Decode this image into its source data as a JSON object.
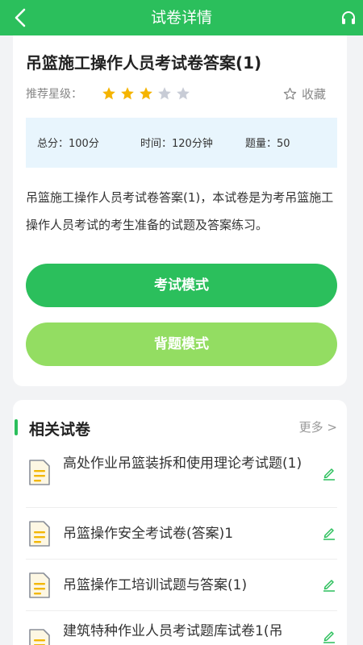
{
  "header": {
    "title": "试卷详情"
  },
  "paper": {
    "title": "吊篮施工操作人员考试卷答案(1)",
    "rating_label": "推荐星级：",
    "rating": 3,
    "rating_max": 5,
    "favorite_label": "收藏",
    "total_score": "总分：100分",
    "time": "时间：120分钟",
    "count": "题量：50",
    "description": "吊篮施工操作人员考试卷答案(1)，本试卷是为考吊篮施工操作人员考试的考生准备的试题及答案练习。",
    "exam_mode": "考试模式",
    "recite_mode": "背题模式"
  },
  "related": {
    "title": "相关试卷",
    "more": "更多 >",
    "items": [
      {
        "title": "高处作业吊篮装拆和使用理论考试题(1)"
      },
      {
        "title": "吊篮操作安全考试卷(答案)1"
      },
      {
        "title": "吊篮操作工培训试题与答案(1)"
      },
      {
        "title": "建筑特种作业人员考试题库试卷1(吊"
      }
    ]
  },
  "colors": {
    "primary": "#2bbf5c",
    "secondary": "#93dd62",
    "star_on": "#f5b400",
    "star_off": "#c8ccd6",
    "info_bg": "#e8f5fd"
  }
}
